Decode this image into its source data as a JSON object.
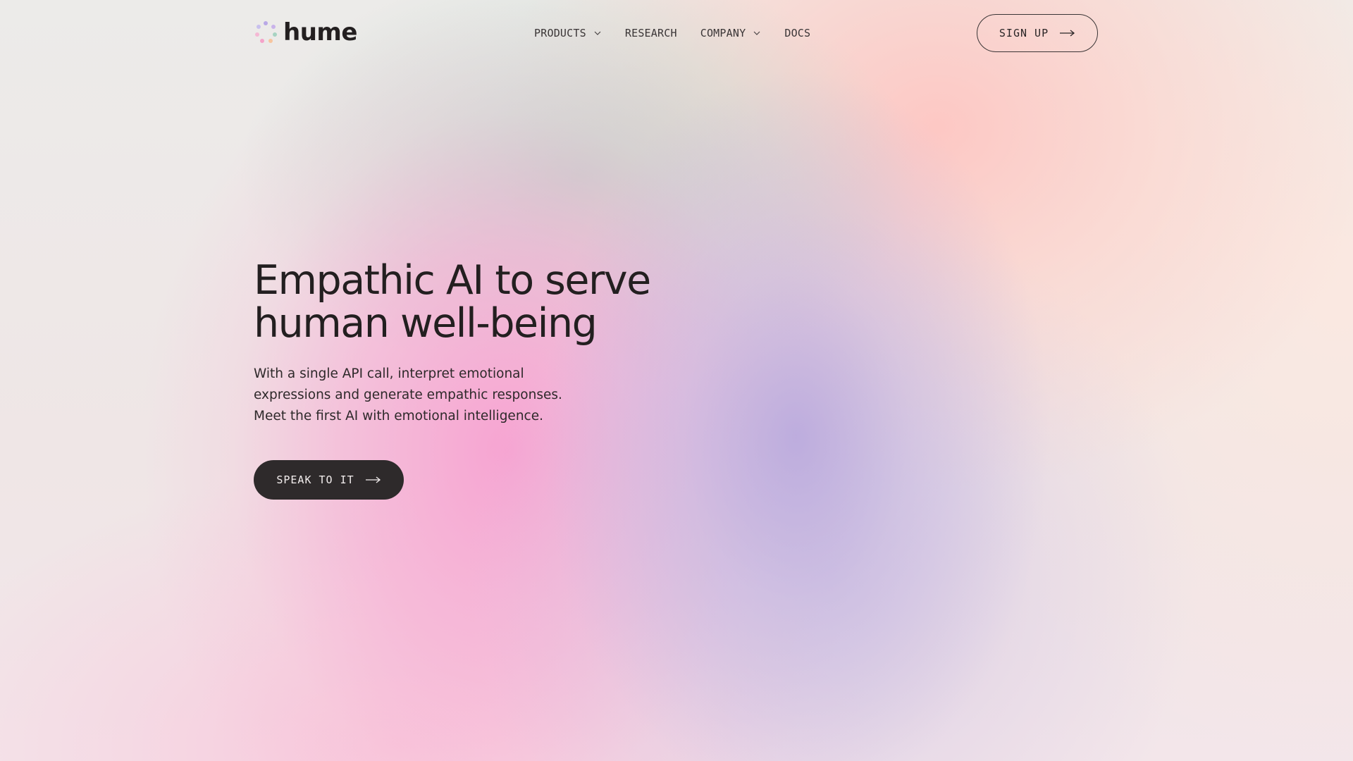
{
  "brand": {
    "name": "hume",
    "logo_icon": "dotted-circle-logo-icon",
    "logo_colors": [
      "#b9a8e6",
      "#f5a3c9",
      "#f7c59f",
      "#a7d3c2"
    ]
  },
  "nav": {
    "items": [
      {
        "label": "PRODUCTS",
        "has_dropdown": true
      },
      {
        "label": "RESEARCH",
        "has_dropdown": false
      },
      {
        "label": "COMPANY",
        "has_dropdown": true
      },
      {
        "label": "DOCS",
        "has_dropdown": false
      }
    ],
    "signup_label": "SIGN UP",
    "dropdown_icon": "chevron-down-icon",
    "arrow_icon": "arrow-right-icon"
  },
  "hero": {
    "headline_lines": [
      "Empathic AI to serve",
      "human well-being"
    ],
    "subtext_lines": [
      "With a single API call, interpret emotional",
      "expressions and generate empathic responses.",
      "Meet the first AI with emotional intelligence."
    ],
    "cta_label": "SPEAK TO IT"
  },
  "colors": {
    "text": "#231f20",
    "cta_background": "#2e2a2b",
    "cta_text": "#f3eeee"
  }
}
